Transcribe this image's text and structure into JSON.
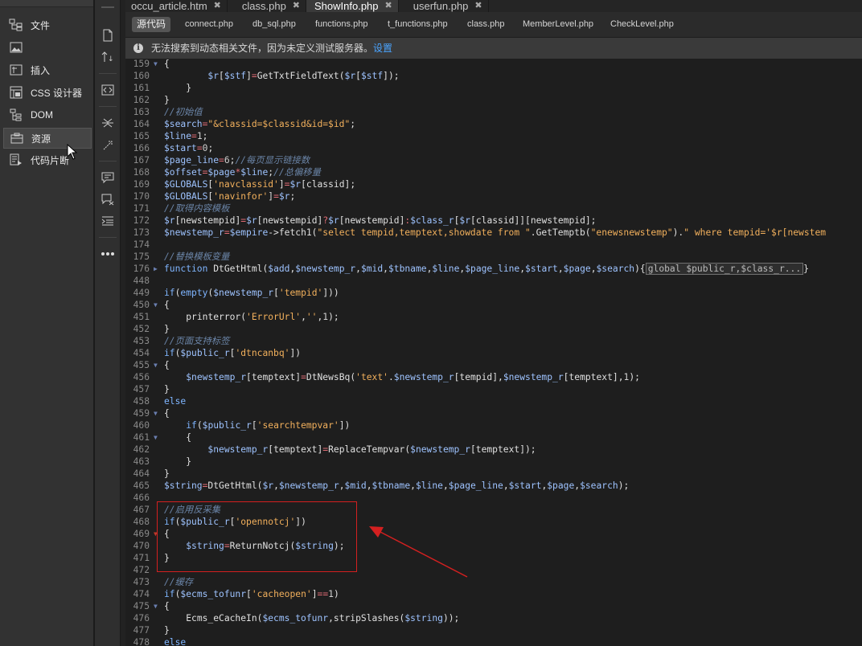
{
  "left_panel": {
    "items": [
      {
        "label": "文件",
        "icon": "files-tree-icon"
      },
      {
        "label": "",
        "icon": "image-icon"
      },
      {
        "label": "插入",
        "icon": "insert-icon"
      },
      {
        "label": "CSS 设计器",
        "icon": "css-designer-icon"
      },
      {
        "label": "DOM",
        "icon": "dom-tree-icon"
      },
      {
        "label": "资源",
        "icon": "assets-icon"
      },
      {
        "label": "代码片断",
        "icon": "snippets-icon"
      }
    ]
  },
  "doc_tabs": [
    {
      "label": "occu_article.htm",
      "closable": true
    },
    {
      "label": "class.php",
      "closable": true
    },
    {
      "label": "ShowInfo.php",
      "closable": true,
      "active": true
    },
    {
      "label": "userfun.php",
      "closable": true
    }
  ],
  "related_files": {
    "source_label": "源代码",
    "files": [
      "connect.php",
      "db_sql.php",
      "functions.php",
      "t_functions.php",
      "class.php",
      "MemberLevel.php",
      "CheckLevel.php"
    ]
  },
  "info_bar": {
    "text": "无法搜索到动态相关文件，因为未定义测试服务器。",
    "link": "设置"
  },
  "code_lines": [
    {
      "n": "159",
      "fold": "▼",
      "code": "{"
    },
    {
      "n": "160",
      "fold": "",
      "code": "\t$r[$stf]=GetTxtFieldText($r[$stf]);"
    },
    {
      "n": "161",
      "fold": "",
      "code": "    }"
    },
    {
      "n": "162",
      "fold": "",
      "code": "}"
    },
    {
      "n": "163",
      "fold": "",
      "code": "//初始值"
    },
    {
      "n": "164",
      "fold": "",
      "code": "$search=\"&classid=$classid&id=$id\";"
    },
    {
      "n": "165",
      "fold": "",
      "code": "$line=1;"
    },
    {
      "n": "166",
      "fold": "",
      "code": "$start=0;"
    },
    {
      "n": "167",
      "fold": "",
      "code": "$page_line=6;//每页显示链接数"
    },
    {
      "n": "168",
      "fold": "",
      "code": "$offset=$page*$line;//总偏移量"
    },
    {
      "n": "169",
      "fold": "",
      "code": "$GLOBALS['navclassid']=$r[classid];"
    },
    {
      "n": "170",
      "fold": "",
      "code": "$GLOBALS['navinfor']=$r;"
    },
    {
      "n": "171",
      "fold": "",
      "code": "//取得内容模板"
    },
    {
      "n": "172",
      "fold": "",
      "code": "$r[newstempid]=$r[newstempid]?$r[newstempid]:$class_r[$r[classid]][newstempid];"
    },
    {
      "n": "173",
      "fold": "",
      "code": "$newstemp_r=$empire->fetch1(\"select tempid,temptext,showdate from \".GetTemptb(\"enewsnewstemp\").\" where tempid='$r[newstem"
    },
    {
      "n": "174",
      "fold": "",
      "code": ""
    },
    {
      "n": "175",
      "fold": "",
      "code": "//替换模板变量"
    },
    {
      "n": "176",
      "fold": "▶",
      "code": "function DtGetHtml($add,$newstemp_r,$mid,$tbname,$line,$page_line,$start,$page,$search){global $public_r,$class_r...}"
    },
    {
      "n": "448",
      "fold": "",
      "code": ""
    },
    {
      "n": "449",
      "fold": "",
      "code": "if(empty($newstemp_r['tempid']))"
    },
    {
      "n": "450",
      "fold": "▼",
      "code": "{"
    },
    {
      "n": "451",
      "fold": "",
      "code": "    printerror('ErrorUrl','',1);"
    },
    {
      "n": "452",
      "fold": "",
      "code": "}"
    },
    {
      "n": "453",
      "fold": "",
      "code": "//页面支持标签"
    },
    {
      "n": "454",
      "fold": "",
      "code": "if($public_r['dtncanbq'])"
    },
    {
      "n": "455",
      "fold": "▼",
      "code": "{"
    },
    {
      "n": "456",
      "fold": "",
      "code": "    $newstemp_r[temptext]=DtNewsBq('text'.$newstemp_r[tempid],$newstemp_r[temptext],1);"
    },
    {
      "n": "457",
      "fold": "",
      "code": "}"
    },
    {
      "n": "458",
      "fold": "",
      "code": "else"
    },
    {
      "n": "459",
      "fold": "▼",
      "code": "{"
    },
    {
      "n": "460",
      "fold": "",
      "code": "    if($public_r['searchtempvar'])"
    },
    {
      "n": "461",
      "fold": "▼",
      "code": "    {"
    },
    {
      "n": "462",
      "fold": "",
      "code": "        $newstemp_r[temptext]=ReplaceTempvar($newstemp_r[temptext]);"
    },
    {
      "n": "463",
      "fold": "",
      "code": "    }"
    },
    {
      "n": "464",
      "fold": "",
      "code": "}"
    },
    {
      "n": "465",
      "fold": "",
      "code": "$string=DtGetHtml($r,$newstemp_r,$mid,$tbname,$line,$page_line,$start,$page,$search);"
    },
    {
      "n": "466",
      "fold": "",
      "code": ""
    },
    {
      "n": "467",
      "fold": "",
      "code": "//启用反采集"
    },
    {
      "n": "468",
      "fold": "",
      "code": "if($public_r['opennotcj'])"
    },
    {
      "n": "469",
      "fold": "▼r",
      "code": "{"
    },
    {
      "n": "470",
      "fold": "",
      "code": "    $string=ReturnNotcj($string);"
    },
    {
      "n": "471",
      "fold": "",
      "code": "}"
    },
    {
      "n": "472",
      "fold": "",
      "code": ""
    },
    {
      "n": "473",
      "fold": "",
      "code": "//缓存"
    },
    {
      "n": "474",
      "fold": "",
      "code": "if($ecms_tofunr['cacheopen']==1)"
    },
    {
      "n": "475",
      "fold": "▼",
      "code": "{"
    },
    {
      "n": "476",
      "fold": "",
      "code": "    Ecms_eCacheIn($ecms_tofunr,stripSlashes($string));"
    },
    {
      "n": "477",
      "fold": "",
      "code": "}"
    },
    {
      "n": "478",
      "fold": "",
      "code": "else"
    }
  ],
  "colors": {
    "editor_bg": "#1e1e1e",
    "annotation_red": "#d42020",
    "link_blue": "#4aa4ff"
  }
}
